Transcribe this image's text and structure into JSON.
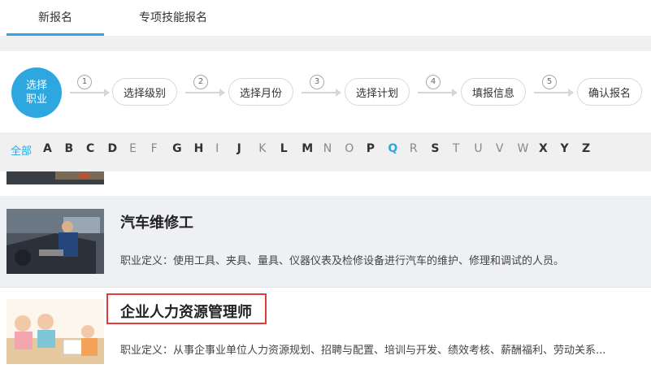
{
  "tabs": [
    {
      "label": "新报名"
    },
    {
      "label": "专项技能报名"
    }
  ],
  "steps": {
    "first": "选择\n职业",
    "items": [
      {
        "num": "1",
        "label": "选择级别"
      },
      {
        "num": "2",
        "label": "选择月份"
      },
      {
        "num": "3",
        "label": "选择计划"
      },
      {
        "num": "4",
        "label": "填报信息"
      },
      {
        "num": "5",
        "label": "确认报名"
      }
    ]
  },
  "alphabet": {
    "all": "全部",
    "letters": [
      "A",
      "B",
      "C",
      "D",
      "E",
      "F",
      "G",
      "H",
      "I",
      "J",
      "K",
      "L",
      "M",
      "N",
      "O",
      "P",
      "Q",
      "R",
      "S",
      "T",
      "U",
      "V",
      "W",
      "X",
      "Y",
      "Z"
    ],
    "bold": [
      "A",
      "B",
      "C",
      "D",
      "G",
      "H",
      "J",
      "L",
      "M",
      "P",
      "S",
      "X",
      "Y",
      "Z"
    ],
    "highlighted": [
      "Q"
    ]
  },
  "occupations": [
    {
      "title": "汽车维修工",
      "definition": "职业定义：使用工具、夹具、量具、仪器仪表及检修设备进行汽车的维护、修理和调试的人员。"
    },
    {
      "title": "企业人力资源管理师",
      "definition": "职业定义：从事企事业单位人力资源规划、招聘与配置、培训与开发、绩效考核、薪酬福利、劳动关系..."
    }
  ],
  "colors": {
    "accent": "#2ea7e0",
    "highlight_border": "#e03c3c"
  }
}
